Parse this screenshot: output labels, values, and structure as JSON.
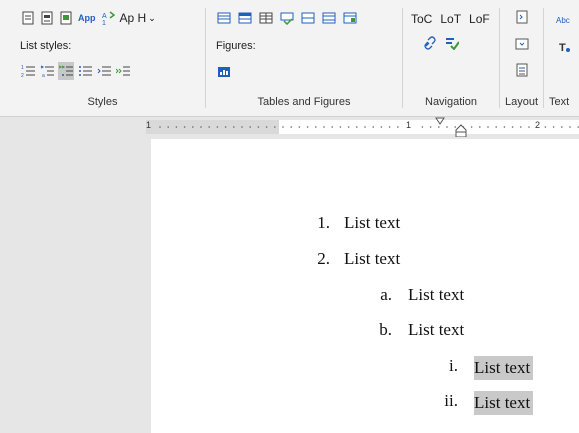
{
  "ribbon": {
    "styles_group": {
      "label": "Styles",
      "app_label": "App",
      "ap_label": "Ap H",
      "list_styles_label": "List styles:"
    },
    "tables_group": {
      "label": "Tables and Figures",
      "figures_label": "Figures:"
    },
    "navigation_group": {
      "label": "Navigation",
      "toc_label": "ToC",
      "lot_label": "LoT",
      "lof_label": "LoF"
    },
    "layout_group": {
      "label": "Layout"
    },
    "text_group": {
      "label": "Text",
      "abc_label": "Abc"
    }
  },
  "ruler": {
    "mark_1": "1",
    "mark_1b": "1",
    "mark_2": "2"
  },
  "document": {
    "list": [
      {
        "marker": "1.",
        "text": "List text",
        "level": 1
      },
      {
        "marker": "2.",
        "text": "List text",
        "level": 1
      },
      {
        "marker": "a.",
        "text": "List text",
        "level": 2
      },
      {
        "marker": "b.",
        "text": "List text",
        "level": 2
      },
      {
        "marker": "i.",
        "text": "List text",
        "level": 3,
        "selected": true
      },
      {
        "marker": "ii.",
        "text": "List text",
        "level": 3,
        "selected": true
      }
    ]
  },
  "colors": {
    "ribbon_bg": "#f3f3f3",
    "accent_blue": "#1f5fbf",
    "accent_green": "#3a9a3a",
    "selection": "#c9c9c9"
  }
}
